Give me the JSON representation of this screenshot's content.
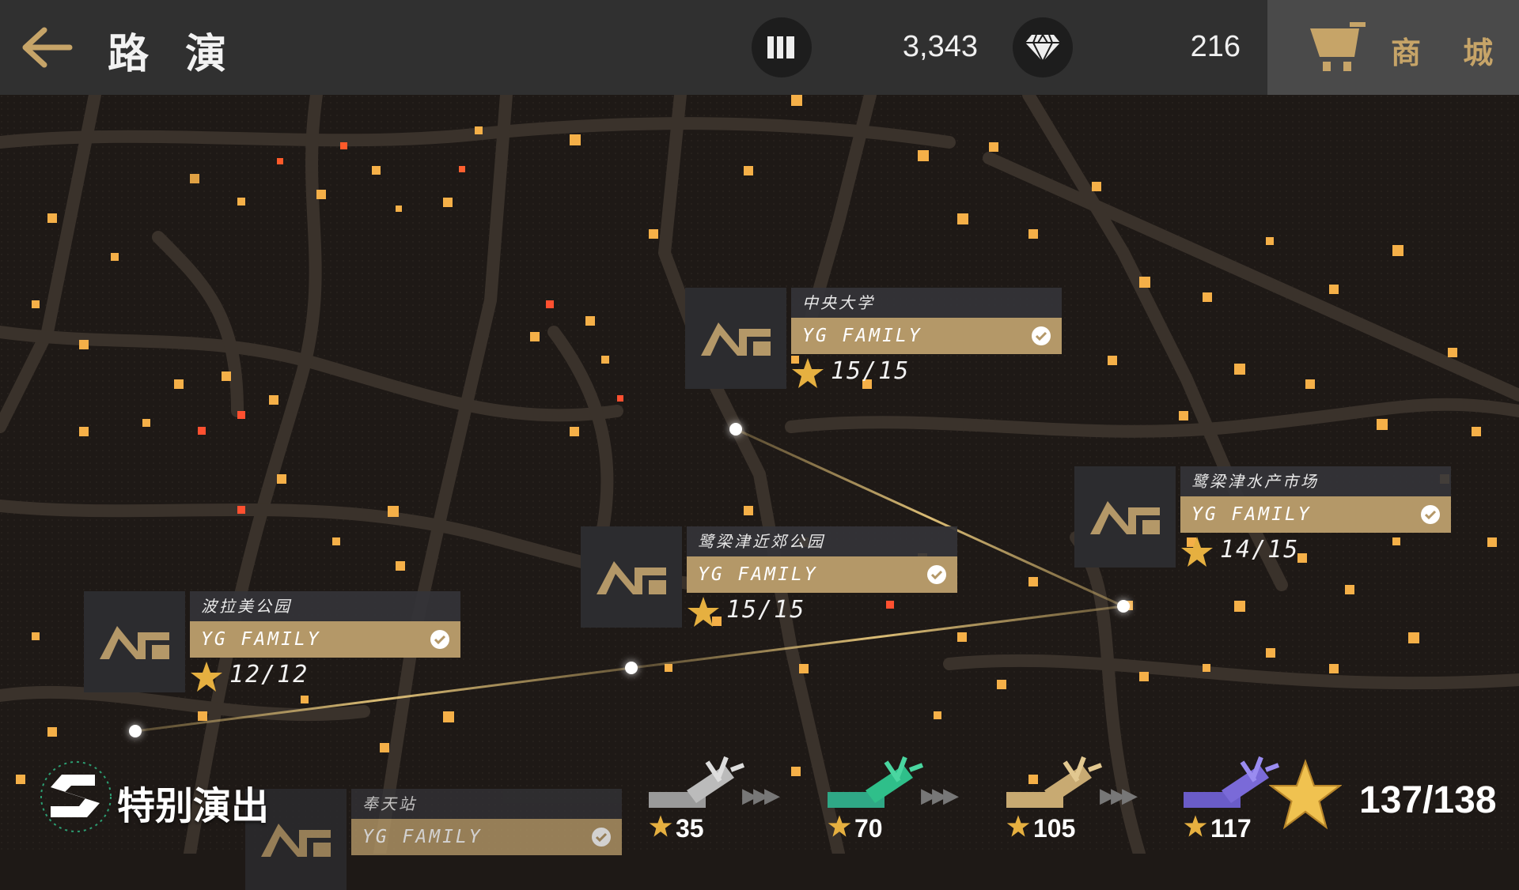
{
  "header": {
    "title": "路 演",
    "currency_a": "3,343",
    "currency_b": "216",
    "shop_label": "商 城",
    "icons": [
      "back-arrow-icon",
      "records-icon",
      "diamond-icon",
      "shop-cart-icon"
    ]
  },
  "stages": [
    {
      "venue": "中央大学",
      "artist": "YG FAMILY",
      "score": "15/15",
      "cleared": true
    },
    {
      "venue": "鹭梁津水产市场",
      "artist": "YG FAMILY",
      "score": "14/15",
      "cleared": true
    },
    {
      "venue": "鹭梁津近郊公园",
      "artist": "YG FAMILY",
      "score": "15/15",
      "cleared": true
    },
    {
      "venue": "波拉美公园",
      "artist": "YG FAMILY",
      "score": "12/12",
      "cleared": true
    },
    {
      "venue": "奉天站",
      "artist": "YG FAMILY",
      "score": "",
      "cleared": true
    }
  ],
  "special": {
    "label": "特别演出"
  },
  "rewards": {
    "tiers": [
      {
        "value": "35",
        "color": "#9a9a9a"
      },
      {
        "value": "70",
        "color": "#2fa886"
      },
      {
        "value": "105",
        "color": "#c8aa72"
      },
      {
        "value": "117",
        "color": "#6a5cc8"
      }
    ],
    "total": "137/138"
  },
  "colors": {
    "accent_gold": "#b49868",
    "bar_bg": "#303030",
    "map_bg": "#1e1916"
  }
}
